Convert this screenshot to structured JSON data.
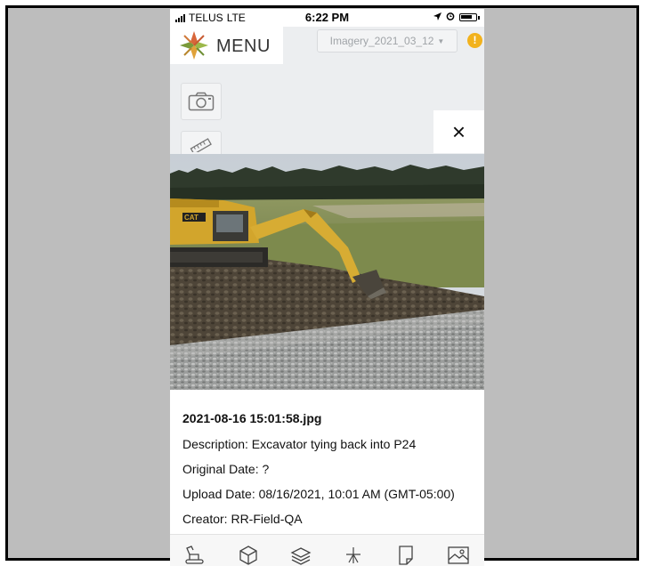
{
  "status_bar": {
    "carrier": "TELUS",
    "network": "LTE",
    "time": "6:22 PM"
  },
  "header": {
    "menu_label": "MENU",
    "imagery_select": "Imagery_2021_03_12",
    "alert_badge": "!"
  },
  "overlay": {
    "close_symbol": "×"
  },
  "photo_info": {
    "filename": "2021-08-16 15:01:58.jpg",
    "description": "Description: Excavator tying back into P24",
    "original_date": "Original Date: ?",
    "upload_date": "Upload Date: 08/16/2021, 10:01 AM (GMT-05:00)",
    "creator": "Creator: RR-Field-QA"
  },
  "toolbar": {
    "icons": [
      "excavator-icon",
      "cube-icon",
      "layers-icon",
      "survey-point-icon",
      "document-icon",
      "image-icon"
    ]
  },
  "colors": {
    "alert": "#f2b21d",
    "panel_bg": "#eceef0",
    "frame_bg": "#bdbdbd"
  }
}
